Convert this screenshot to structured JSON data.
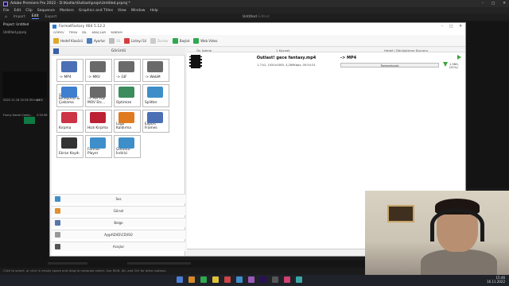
{
  "premiere": {
    "title": "Adobe Premiere Pro 2022 - D:\\Kodlar\\Outlast\\proje\\Untitled.prproj *",
    "menu": [
      "File",
      "Edit",
      "Clip",
      "Sequence",
      "Markers",
      "Graphics and Titles",
      "View",
      "Window",
      "Help"
    ],
    "workspaces": [
      "Import",
      "Edit",
      "Export"
    ],
    "active_workspace": "Edit",
    "center_label": "Untitled",
    "center_sub": "Edited",
    "project_tab": "Project: Untitled",
    "project_file": "Untitled.prproj",
    "clip_time": "2022-11-16 10:34:39.mp4",
    "clip_length": "0:00",
    "clip2_name": "Funny Game Comic...",
    "clip2_length": "2:34:36",
    "status_text": "Click to select, or click in empty space and drag to marquee select. Use Shift, Alt, and Ctrl for other options."
  },
  "formatfactory": {
    "title": "FormatFactory X64 5.12.2",
    "menu": [
      "GÖREV",
      "TEMA",
      "DİL",
      "ARAÇLAR",
      "YARDIM"
    ],
    "toolbar": [
      {
        "label": "Hedef Klasörü",
        "color": "#e0a829",
        "disabled": false
      },
      {
        "label": "Ayarlar",
        "color": "#4f7ebf",
        "disabled": false
      },
      {
        "label": "Sil",
        "color": "#bbbbbb",
        "disabled": true
      },
      {
        "label": "Listeyi Sil",
        "color": "#d34040",
        "disabled": false
      },
      {
        "label": "Durdur",
        "color": "#cccccc",
        "disabled": true
      },
      {
        "label": "Başlat",
        "color": "#2fa84f",
        "disabled": false
      },
      {
        "label": "Web Video",
        "color": "#2fa84f",
        "disabled": false
      }
    ],
    "category_video": "Görüntü",
    "tiles": [
      {
        "label": "-> MP4",
        "color": "#4a6fb5"
      },
      {
        "label": "-> MKV",
        "color": "#6a6a6a"
      },
      {
        "label": "-> GIF",
        "color": "#6a6a6a"
      },
      {
        "label": "-> WebM",
        "color": "#6a6a6a"
      },
      {
        "label": "Görüntü Birleştirici & Çoklama",
        "color": "#3f7fcf"
      },
      {
        "label": "-> AVI FLV MOV Etc...",
        "color": "#6a6a6a"
      },
      {
        "label": "Optimize",
        "color": "#3c8c5c"
      },
      {
        "label": "Splitter",
        "color": "#3e8fc9"
      },
      {
        "label": "Kırpma",
        "color": "#cc3344"
      },
      {
        "label": "Hızlı Kırpma",
        "color": "#bb2233"
      },
      {
        "label": "Logo Kaldırma",
        "color": "#e07a20"
      },
      {
        "label": "Export Frames",
        "color": "#4a6fb5"
      },
      {
        "label": "Ekran Kaydı",
        "color": "#333333"
      },
      {
        "label": "Format Player",
        "color": "#3e8fc9"
      },
      {
        "label": "Görüntü İndirici",
        "color": "#3e8fc9"
      }
    ],
    "categories": [
      {
        "label": "Ses",
        "color": "#3e8fc9"
      },
      {
        "label": "Görsel",
        "color": "#e09030"
      },
      {
        "label": "Belge",
        "color": "#5577aa"
      },
      {
        "label": "Aygıt\\DVD\\CD\\ISO",
        "color": "#999999"
      },
      {
        "label": "Araçlar",
        "color": "#555555"
      }
    ],
    "list_headers": {
      "preview": "Ön İzleme",
      "source": "1 Kaynak",
      "target": "Hedef / Dönüştürme Durumu"
    },
    "task": {
      "file_name": "Outlast! gece fantasy.mp4",
      "meta": "1.71G, 1920x1080, 4,289Kbps, 00:54:31",
      "target_format": "-> MP4",
      "status": "Tamamlandı",
      "elapsed": "1.36G, (91%)"
    }
  },
  "taskbar": {
    "time": "15:46",
    "date": "16.11.2022"
  }
}
